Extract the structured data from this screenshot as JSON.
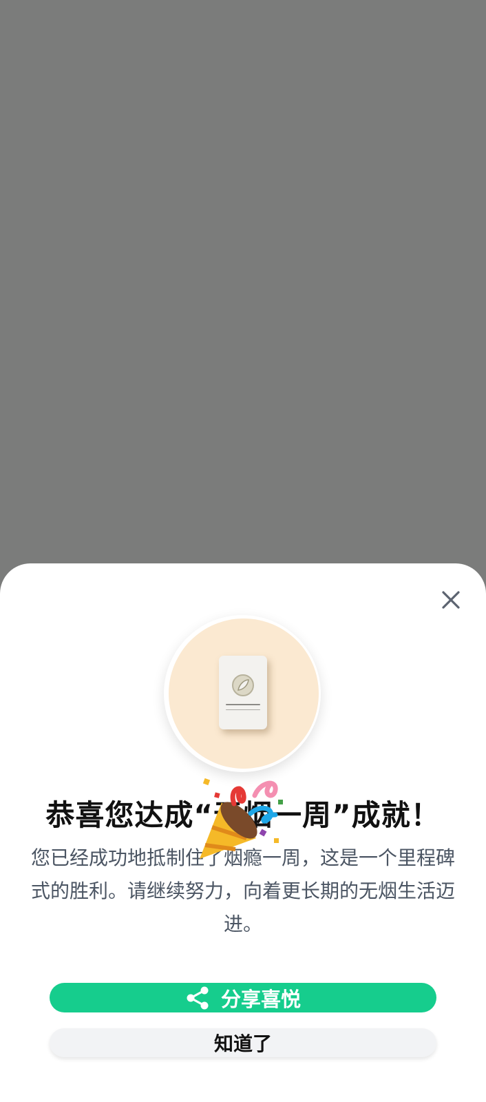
{
  "dialog": {
    "title": "恭喜您达成“无烟一周”成就！",
    "description": "您已经成功地抵制住了烟瘾一周，这是一个里程碑式的胜利。请继续努力，向着更长期的无烟生活迈进。",
    "share_label": "分享喜悦",
    "ok_label": "知道了",
    "badge_card_text": "SMOKE FREE"
  },
  "icons": {
    "close": "close-icon",
    "share": "share-icon",
    "confetti": "party-popper-icon",
    "card_logo": "leaf-logo-icon"
  },
  "colors": {
    "overlay": "#7b7c7b",
    "accent": "#16cd8d",
    "badge_bg": "#fbe9d1",
    "secondary_button": "#f2f3f5"
  }
}
